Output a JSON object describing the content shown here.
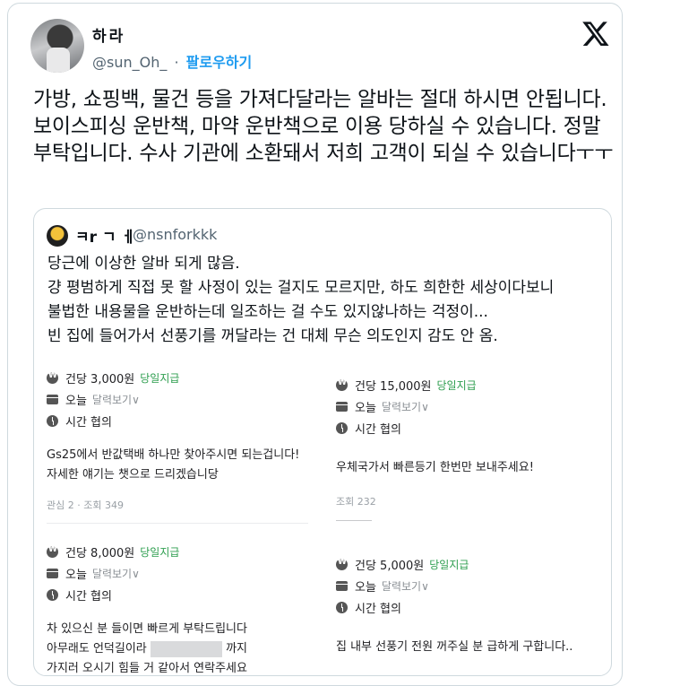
{
  "author": {
    "name": "하라",
    "handle": "@sun_Oh_",
    "separator": "·",
    "follow_label": "팔로우하기"
  },
  "tweet": {
    "text": "가방, 쇼핑백, 물건 등을 가져다달라는 알바는 절대 하시면 안됩니다. 보이스피싱 운반책, 마약 운반책으로 이용 당하실 수 있습니다. 정말 부탁입니다. 수사 기관에 소환돼서 저희 고객이 되실 수 있습니다ㅜㅜ"
  },
  "quote": {
    "name": "ㅋr ㄱ ㅔ",
    "handle": "@nsnforkkk",
    "lines": [
      "당근에 이상한 알바 되게 많음.",
      "걍 평범하게 직접 못 할 사정이 있는 걸지도 모르지만, 하도 희한한 세상이다보니",
      "불법한 내용물을 운반하는데 일조하는 걸 수도 있지않나하는 걱정이...",
      "빈 집에 들어가서 선풍기를 꺼달라는 건 대체 무슨 의도인지 감도 안 옴."
    ]
  },
  "listings": [
    {
      "price": "건당 3,000원",
      "pay_tag": "당일지급",
      "date": "오늘",
      "date_sub": "달력보기∨",
      "time": "시간 협의",
      "desc": "Gs25에서 반값택배 하나만 찾아주시면 되는겁니다! 자세한 얘기는 챗으로 드리겠습니당",
      "stats": "관심 2 · 조회 349"
    },
    {
      "price": "건당 15,000원",
      "pay_tag": "당일지급",
      "date": "오늘",
      "date_sub": "달력보기∨",
      "time": "시간 협의",
      "desc": "우체국가서 빠른등기 한번만 보내주세요!",
      "stats": "조회 232"
    },
    {
      "price": "건당 8,000원",
      "pay_tag": "당일지급",
      "date": "오늘",
      "date_sub": "달력보기∨",
      "time": "시간 협의",
      "desc_line1": "차 있으신 분 들이면 빠르게 부탁드립니다",
      "desc_line2_pre": "아무래도 언덕길이라",
      "desc_line2_post": "까지",
      "desc_line3": "가지러 오시기 힘들 거 같아서 연락주세요"
    },
    {
      "price": "건당 5,000원",
      "pay_tag": "당일지급",
      "date": "오늘",
      "date_sub": "달력보기∨",
      "time": "시간 협의",
      "desc": "집 내부 선풍기 전원 꺼주실 분 급하게 구합니다.."
    }
  ]
}
